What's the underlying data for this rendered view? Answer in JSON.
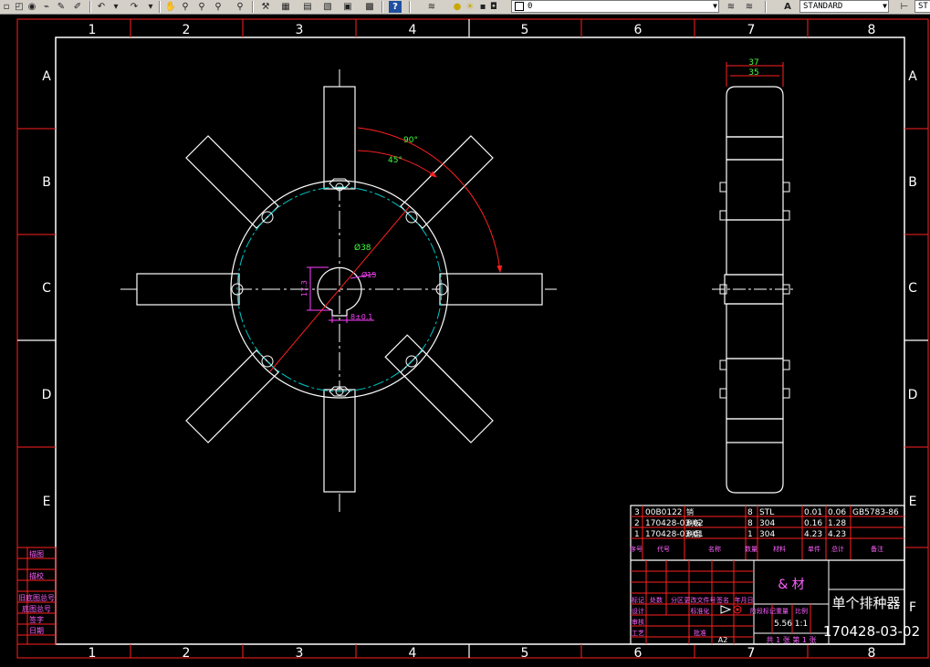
{
  "toolbar": {
    "layer_value": "0",
    "textstyle_value": "STANDARD",
    "dimstyle_value": "ST"
  },
  "sheet": {
    "col_labels": [
      "1",
      "2",
      "3",
      "4",
      "5",
      "6",
      "7",
      "8"
    ],
    "row_labels": [
      "A",
      "B",
      "C",
      "D",
      "E",
      "F"
    ]
  },
  "dims": {
    "angle_outer": "90°",
    "angle_inner": "45°",
    "dia_outer": "Ø38",
    "dia_hole": "Ø15",
    "key_height": "17.3",
    "key_width": "8±0.1",
    "width_outer": "37",
    "width_inner": "35"
  },
  "title_block": {
    "parts": [
      {
        "no": "3",
        "code": "00B0122",
        "name": "销",
        "qty": "8",
        "material": "STL",
        "unit_w": "0.01",
        "total_w": "0.06",
        "note": "GB5783-86"
      },
      {
        "no": "2",
        "code": "170428-03-02",
        "name": "刷板",
        "qty": "8",
        "material": "304",
        "unit_w": "0.16",
        "total_w": "1.28",
        "note": ""
      },
      {
        "no": "1",
        "code": "170428-03-01",
        "name": "刷盘",
        "qty": "1",
        "material": "304",
        "unit_w": "4.23",
        "total_w": "4.23",
        "note": ""
      }
    ],
    "headers": [
      "序号",
      "代号",
      "名称",
      "数量",
      "材料",
      "单件",
      "总计",
      "备注"
    ],
    "material_label": "&\n材",
    "drawing_name": "单个排种器",
    "drawing_code": "170428-03-02",
    "scale": "1:1",
    "stage_label": "阶段标记",
    "weight_label": "重量",
    "ratio_label": "比例",
    "mass": "5.56",
    "sheet_info": "共 1 张  第 1 张",
    "paper": "A2",
    "labels": [
      "标记",
      "处数",
      "分区",
      "更改文件号",
      "签名",
      "年月日",
      "设计",
      "标准化",
      "审核",
      "工艺",
      "批准",
      "共",
      "第",
      "张"
    ],
    "left_strip": [
      "描图",
      "描校",
      "旧底图总号",
      "底图总号",
      "签字",
      "日期"
    ]
  }
}
